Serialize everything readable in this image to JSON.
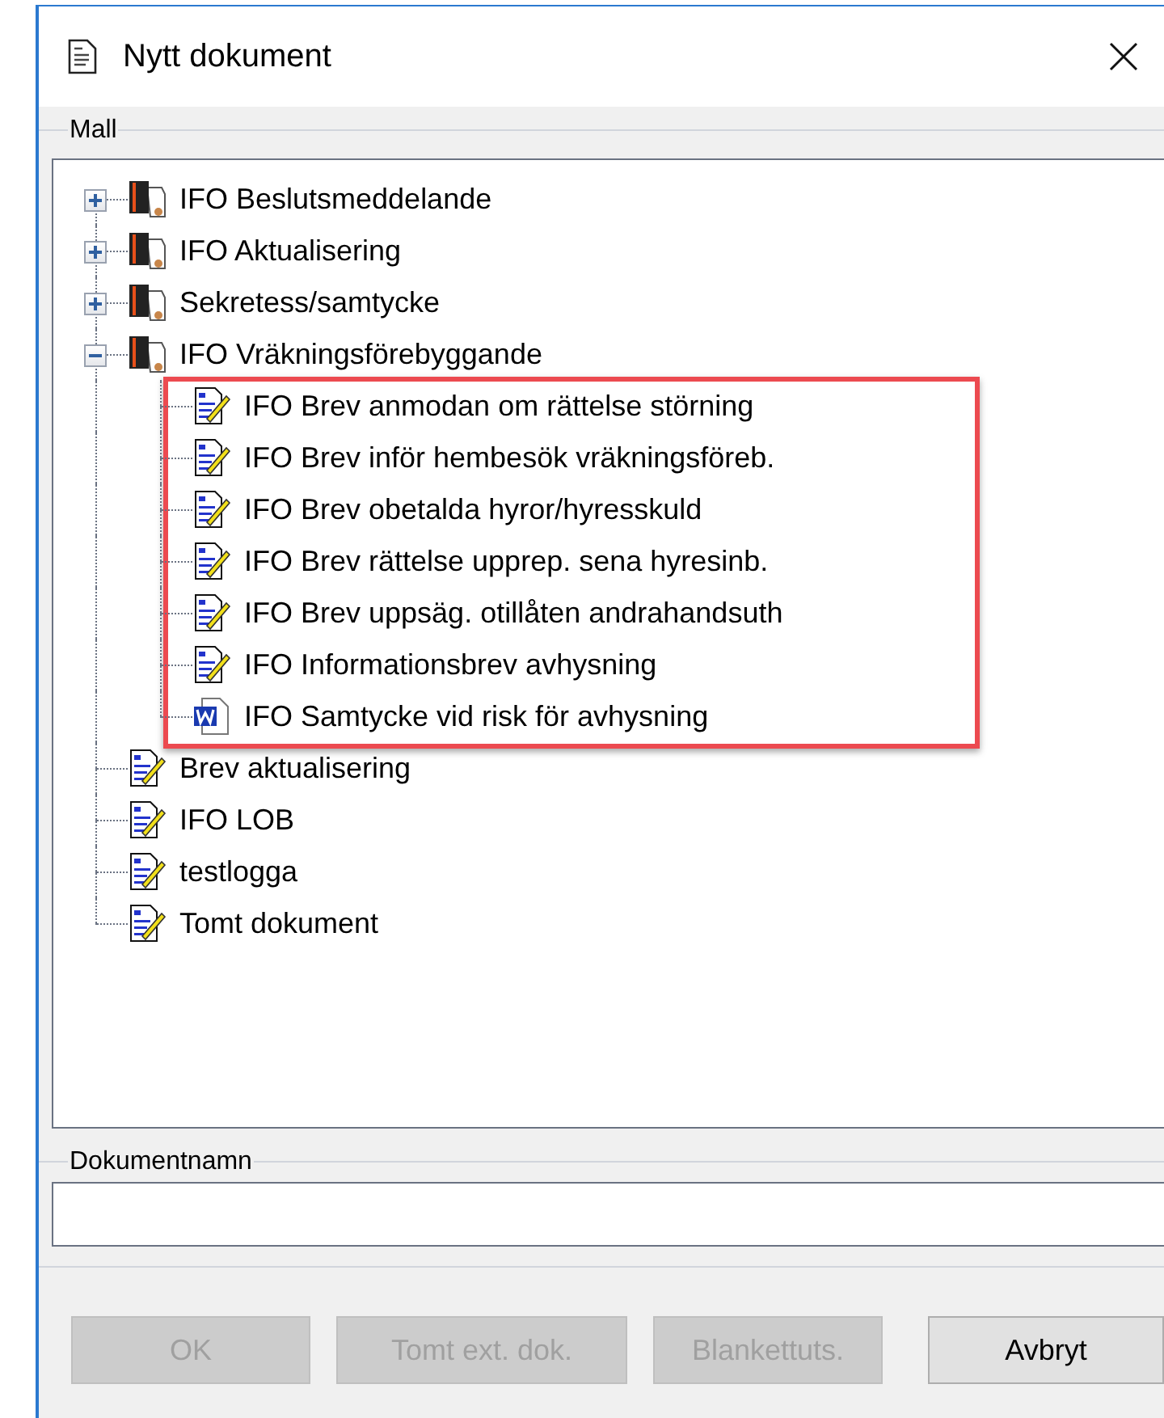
{
  "window": {
    "title": "Nytt dokument"
  },
  "template_group": {
    "label": "Mall"
  },
  "tree": [
    {
      "label": "IFO Beslutsmeddelande",
      "kind": "folder",
      "expanded": false
    },
    {
      "label": "IFO Aktualisering",
      "kind": "folder",
      "expanded": false
    },
    {
      "label": "Sekretess/samtycke",
      "kind": "folder",
      "expanded": false
    },
    {
      "label": "IFO Vräkningsförebyggande",
      "kind": "folder",
      "expanded": true,
      "highlighted_children": true,
      "children": [
        {
          "label": "IFO Brev anmodan om rättelse störning",
          "kind": "template"
        },
        {
          "label": "IFO Brev inför hembesök vräkningsföreb.",
          "kind": "template"
        },
        {
          "label": "IFO Brev obetalda hyror/hyresskuld",
          "kind": "template"
        },
        {
          "label": "IFO Brev rättelse upprep. sena hyresinb.",
          "kind": "template"
        },
        {
          "label": "IFO Brev uppsäg. otillåten andrahandsuth",
          "kind": "template"
        },
        {
          "label": "IFO Informationsbrev avhysning",
          "kind": "template"
        },
        {
          "label": "IFO Samtycke vid risk för avhysning",
          "kind": "word"
        }
      ]
    },
    {
      "label": "Brev aktualisering",
      "kind": "template"
    },
    {
      "label": "IFO LOB",
      "kind": "template"
    },
    {
      "label": "testlogga",
      "kind": "template"
    },
    {
      "label": "Tomt dokument",
      "kind": "template"
    }
  ],
  "name_group": {
    "label": "Dokumentnamn"
  },
  "buttons": [
    {
      "label": "OK",
      "disabled": true
    },
    {
      "label": "Tomt ext. dok.",
      "disabled": true
    },
    {
      "label": "Blankettuts.",
      "disabled": true
    },
    {
      "label": "Avbryt",
      "disabled": false
    }
  ]
}
